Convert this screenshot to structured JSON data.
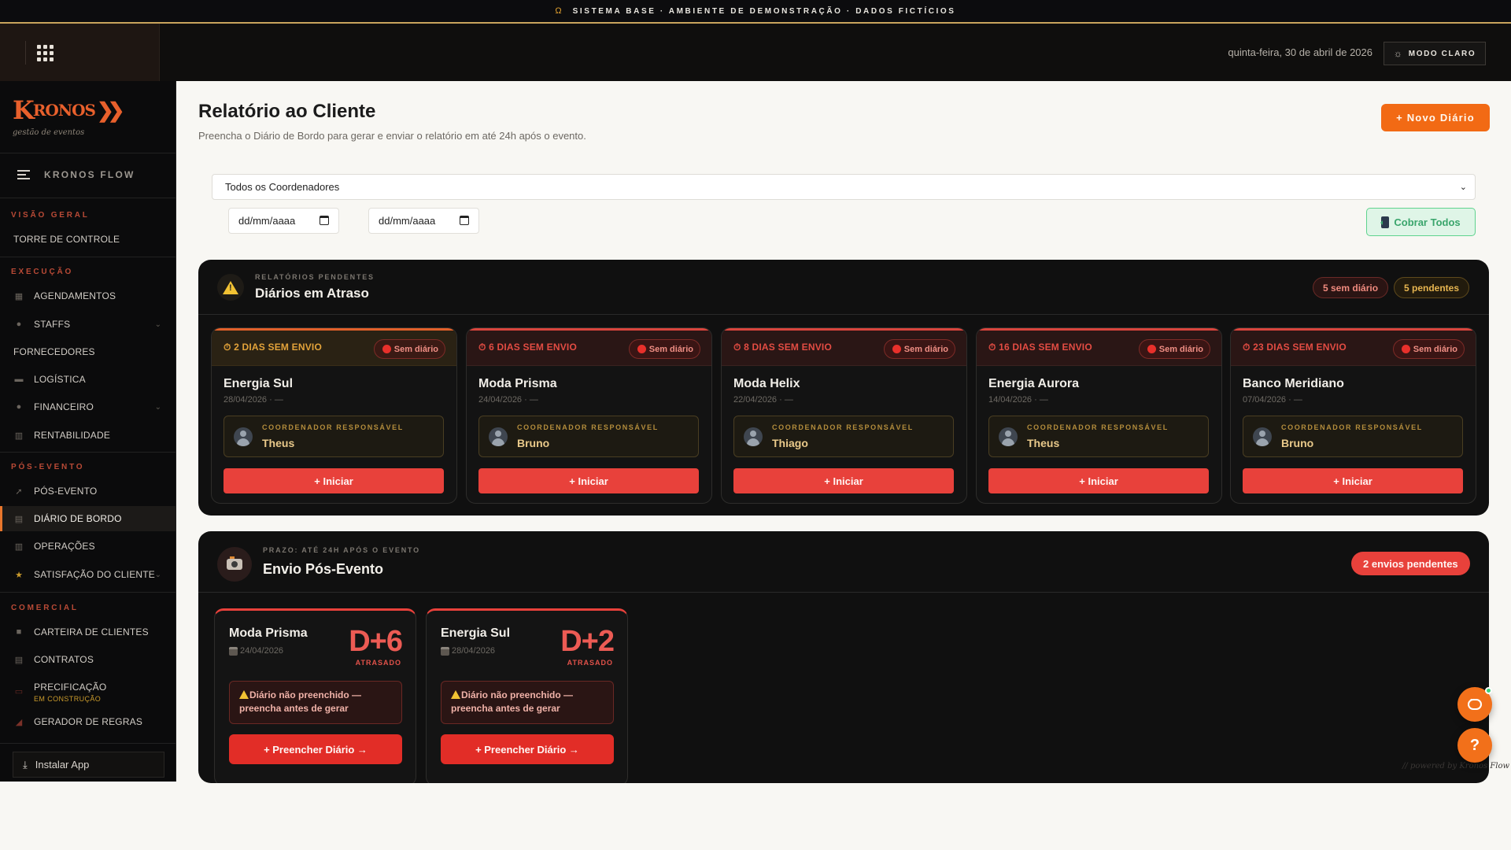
{
  "banner": {
    "icon": "omega-icon",
    "omega": "Ω",
    "text": "SISTEMA BASE · AMBIENTE DE DEMONSTRAÇÃO · DADOS FICTÍCIOS"
  },
  "topbar": {
    "date": "quinta-feira, 30 de abril de 2026",
    "mode_button": "MODO CLARO"
  },
  "brand": {
    "logo_k": "K",
    "logo_rest": "RONOS",
    "logo_arrows": "❯❯",
    "tagline": "gestão de eventos"
  },
  "sidebar": {
    "app_name": "KRONOS FLOW",
    "sections": {
      "overview": "VISÃO GERAL",
      "execution": "EXECUÇÃO",
      "post_event": "PÓS-EVENTO",
      "commercial": "COMERCIAL"
    },
    "items": {
      "torre": "TORRE DE CONTROLE",
      "agendamentos": "AGENDAMENTOS",
      "staffs": "STAFFS",
      "fornecedores": "FORNECEDORES",
      "logistica": "LOGÍSTICA",
      "financeiro": "FINANCEIRO",
      "rentabilidade": "RENTABILIDADE",
      "pos_evento": "PÓS-EVENTO",
      "diario": "DIÁRIO DE BORDO",
      "operacoes": "OPERAÇÕES",
      "satisfacao": "SATISFAÇÃO DO CLIENTE",
      "carteira": "CARTEIRA DE CLIENTES",
      "contratos": "CONTRATOS",
      "precificacao": "PRECIFICAÇÃO",
      "precificacao_sub": "EM CONSTRUÇÃO",
      "gerador": "GERADOR DE REGRAS"
    },
    "install": "Instalar App"
  },
  "page": {
    "title": "Relatório ao Cliente",
    "subtitle": "Preencha o Diário de Bordo para gerar e enviar o relatório em até 24h após o evento.",
    "new_button": "+ Novo Diário"
  },
  "filters": {
    "coordinator": "Todos os Coordenadores",
    "date_from": "dd/mm/aaaa",
    "date_to": "dd/mm/aaaa",
    "cobrar": "Cobrar Todos"
  },
  "overdue": {
    "kicker": "RELATÓRIOS PENDENTES",
    "title": "Diários em Atraso",
    "badge_no_diary": "5 sem diário",
    "badge_pending": "5 pendentes",
    "coord_label": "COORDENADOR RESPONSÁVEL",
    "pill": "Sem diário",
    "start": "+ Iniciar",
    "cards": [
      {
        "days": "⏱ 2 DIAS SEM ENVIO",
        "name": "Energia Sul",
        "date": "28/04/2026 · —",
        "coordinator": "Theus"
      },
      {
        "days": "⏱ 6 DIAS SEM ENVIO",
        "name": "Moda Prisma",
        "date": "24/04/2026 · —",
        "coordinator": "Bruno"
      },
      {
        "days": "⏱ 8 DIAS SEM ENVIO",
        "name": "Moda Helix",
        "date": "22/04/2026 · —",
        "coordinator": "Thiago"
      },
      {
        "days": "⏱ 16 DIAS SEM ENVIO",
        "name": "Energia Aurora",
        "date": "14/04/2026 · —",
        "coordinator": "Theus"
      },
      {
        "days": "⏱ 23 DIAS SEM ENVIO",
        "name": "Banco Meridiano",
        "date": "07/04/2026 · —",
        "coordinator": "Bruno"
      }
    ]
  },
  "post_event": {
    "kicker": "PRAZO: ATÉ 24H APÓS O EVENTO",
    "title": "Envio Pós-Evento",
    "badge": "2 envios pendentes",
    "late": "ATRASADO",
    "warning": "Diário não preenchido — preencha antes de gerar",
    "button": "+ Preencher Diário →",
    "cards": [
      {
        "name": "Moda Prisma",
        "date": "24/04/2026",
        "delay": "D+6"
      },
      {
        "name": "Energia Sul",
        "date": "28/04/2026",
        "delay": "D+2"
      }
    ]
  },
  "footer": {
    "powered": "// powered by Kronos Flow"
  },
  "colors": {
    "accent": "#f26a14",
    "danger": "#e8413b",
    "success": "#5fd38e",
    "panel": "#101010"
  }
}
